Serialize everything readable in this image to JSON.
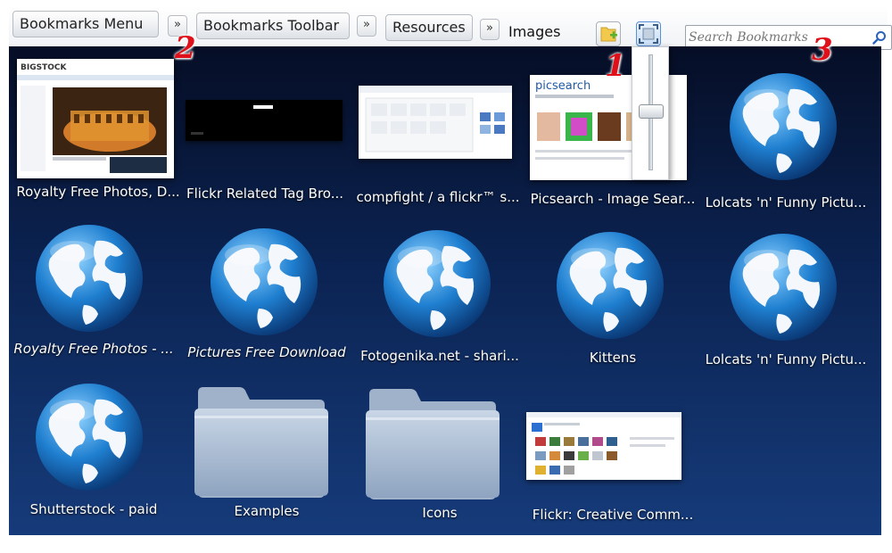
{
  "breadcrumb": {
    "items": [
      "Bookmarks Menu",
      "Bookmarks Toolbar",
      "Resources"
    ],
    "separator": "»",
    "current": "Images"
  },
  "search": {
    "placeholder": "Search Bookmarks"
  },
  "annotations": [
    "1",
    "2",
    "3"
  ],
  "colors": {
    "background_top": "#060e26",
    "background_bottom": "#163b7a",
    "annotation": "#e0101a",
    "label": "#ffffff"
  },
  "grid": {
    "items": [
      {
        "label": "Royalty Free Photos, D...",
        "kind": "thumbnail",
        "icon": "bigstock-thumbnail"
      },
      {
        "label": "Flickr Related Tag Bro...",
        "kind": "thumbnail",
        "icon": "dark-page-thumbnail"
      },
      {
        "label": "compfight / a flickr™ s...",
        "kind": "thumbnail",
        "icon": "compfight-thumbnail"
      },
      {
        "label": "Picsearch - Image Sear...",
        "kind": "thumbnail",
        "icon": "picsearch-thumbnail"
      },
      {
        "label": "Lolcats 'n' Funny Pictu...",
        "kind": "globe",
        "icon": "globe-icon"
      },
      {
        "label": "Royalty Free Photos - ...",
        "kind": "globe",
        "icon": "globe-icon"
      },
      {
        "label": "Pictures Free Download",
        "kind": "globe",
        "icon": "globe-icon"
      },
      {
        "label": "Fotogenika.net - shari...",
        "kind": "globe",
        "icon": "globe-icon"
      },
      {
        "label": "Kittens",
        "kind": "globe",
        "icon": "globe-icon"
      },
      {
        "label": "Lolcats 'n' Funny Pictu...",
        "kind": "globe",
        "icon": "globe-icon"
      },
      {
        "label": "Shutterstock - paid",
        "kind": "globe",
        "icon": "globe-icon"
      },
      {
        "label": "Examples",
        "kind": "folder",
        "icon": "folder-icon"
      },
      {
        "label": "Icons",
        "kind": "folder",
        "icon": "folder-icon"
      },
      {
        "label": "Flickr: Creative Comm...",
        "kind": "thumbnail",
        "icon": "flickr-thumbnail"
      }
    ]
  },
  "thumbnail_text": {
    "bigstock": "BIGSTOCK",
    "picsearch": "picsearch"
  }
}
